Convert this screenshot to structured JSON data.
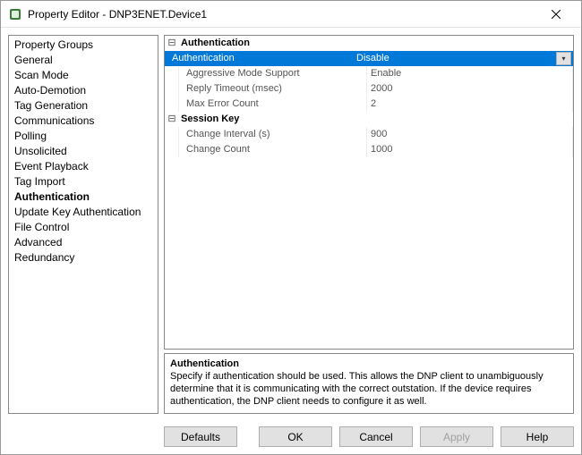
{
  "window": {
    "title": "Property Editor - DNP3ENET.Device1"
  },
  "sidebar": {
    "header": "Property Groups",
    "items": [
      {
        "label": "General"
      },
      {
        "label": "Scan Mode"
      },
      {
        "label": "Auto-Demotion"
      },
      {
        "label": "Tag Generation"
      },
      {
        "label": "Communications"
      },
      {
        "label": "Polling"
      },
      {
        "label": "Unsolicited"
      },
      {
        "label": "Event Playback"
      },
      {
        "label": "Tag Import"
      },
      {
        "label": "Authentication",
        "selected": true
      },
      {
        "label": "Update Key Authentication"
      },
      {
        "label": "File Control"
      },
      {
        "label": "Advanced"
      },
      {
        "label": "Redundancy"
      }
    ]
  },
  "grid": {
    "sections": [
      {
        "title": "Authentication",
        "rows": [
          {
            "label": "Authentication",
            "value": "Disable",
            "selected": true,
            "dropdown": true
          },
          {
            "label": "Aggressive Mode Support",
            "value": "Enable"
          },
          {
            "label": "Reply Timeout (msec)",
            "value": "2000"
          },
          {
            "label": "Max Error Count",
            "value": "2"
          }
        ]
      },
      {
        "title": "Session Key",
        "rows": [
          {
            "label": "Change Interval (s)",
            "value": "900"
          },
          {
            "label": "Change Count",
            "value": "1000"
          }
        ]
      }
    ]
  },
  "description": {
    "title": "Authentication",
    "body": "Specify if authentication should be used. This allows the DNP client to unambiguously determine that it is communicating with the correct outstation. If the device requires authentication, the DNP client needs to configure it as well."
  },
  "buttons": {
    "defaults": "Defaults",
    "ok": "OK",
    "cancel": "Cancel",
    "apply": "Apply",
    "help": "Help"
  }
}
